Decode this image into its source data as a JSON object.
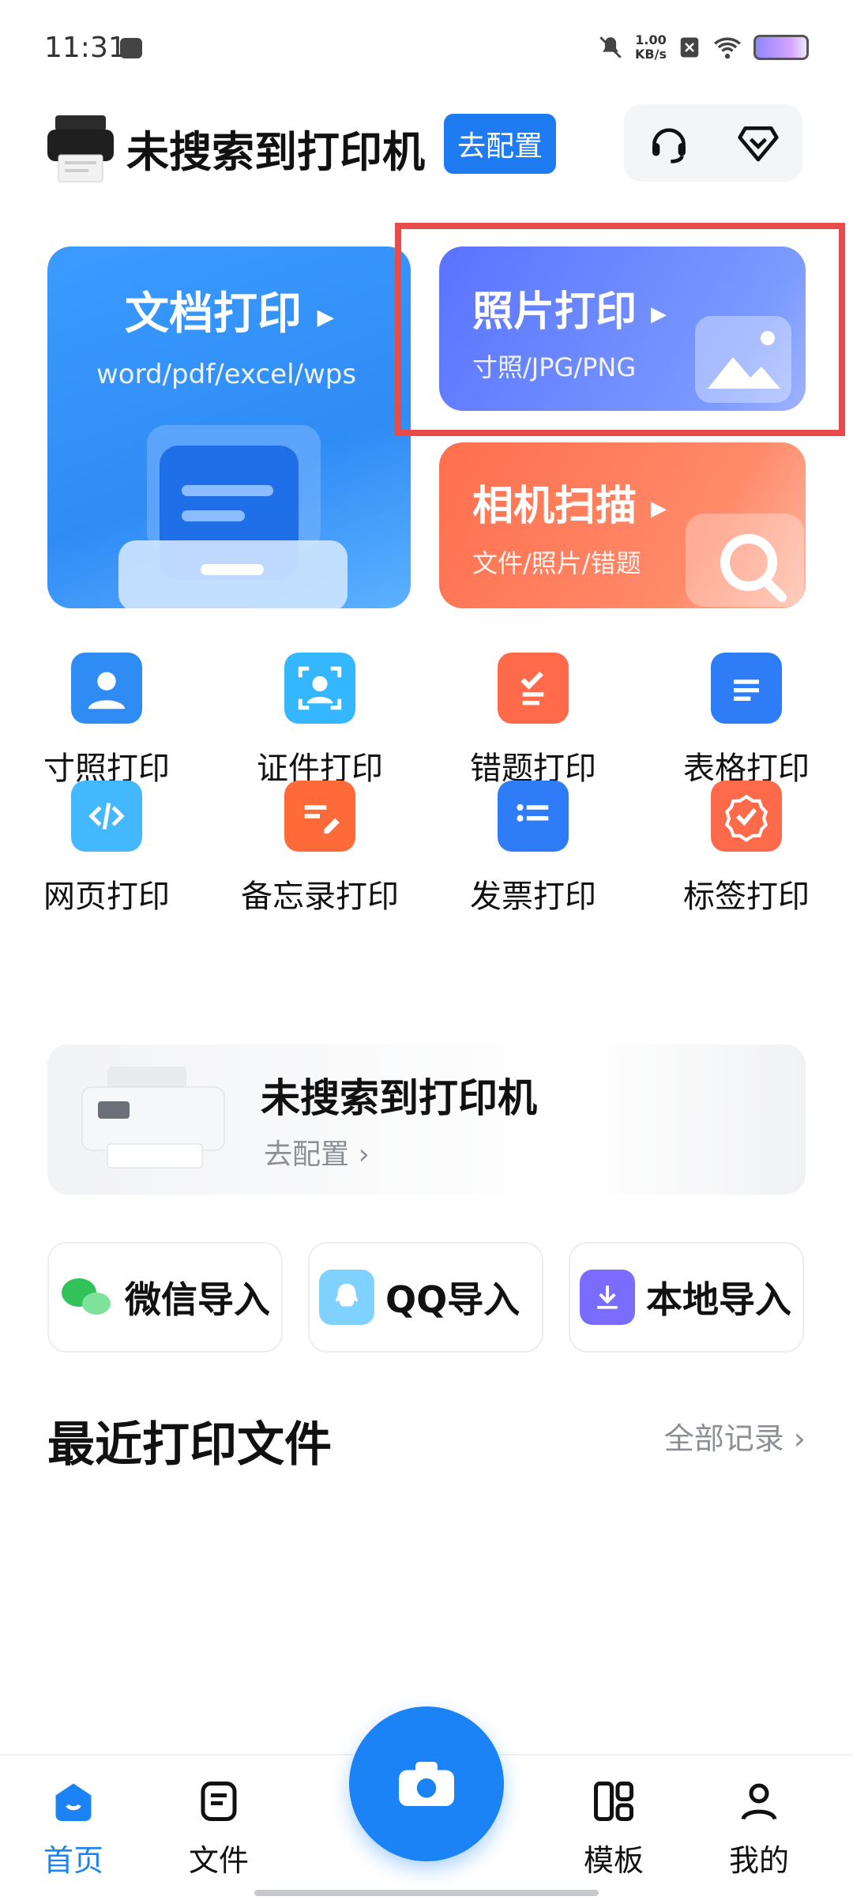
{
  "status": {
    "time": "11:31",
    "speed_value": "1.00",
    "speed_unit": "KB/s"
  },
  "header": {
    "title": "未搜索到打印机",
    "config_label": "去配置"
  },
  "cards": {
    "doc": {
      "title": "文档打印",
      "sub": "word/pdf/excel/wps"
    },
    "photo": {
      "title": "照片打印",
      "sub": "寸照/JPG/PNG"
    },
    "scan": {
      "title": "相机扫描",
      "sub": "文件/照片/错题"
    }
  },
  "grid": [
    {
      "label": "寸照打印",
      "icon": "id-photo-icon",
      "color": "#2f8cf5"
    },
    {
      "label": "证件打印",
      "icon": "id-card-icon",
      "color": "#35b7ff"
    },
    {
      "label": "错题打印",
      "icon": "checklist-icon",
      "color": "#ff6a4a"
    },
    {
      "label": "表格打印",
      "icon": "document-icon",
      "color": "#2f7df6"
    },
    {
      "label": "网页打印",
      "icon": "code-icon",
      "color": "#43b8ff"
    },
    {
      "label": "备忘录打印",
      "icon": "memo-icon",
      "color": "#ff6a39"
    },
    {
      "label": "发票打印",
      "icon": "list-icon",
      "color": "#2f7df6"
    },
    {
      "label": "标签打印",
      "icon": "badge-icon",
      "color": "#ff6a4a"
    }
  ],
  "banner": {
    "title": "未搜索到打印机",
    "sub": "去配置 ›"
  },
  "imports": [
    {
      "label": "微信导入",
      "icon": "wechat-icon",
      "color": "#33c25a"
    },
    {
      "label": "QQ导入",
      "icon": "qq-icon",
      "color": "#46b8ff"
    },
    {
      "label": "本地导入",
      "icon": "download-icon",
      "color": "#7a6cff"
    }
  ],
  "recent": {
    "title": "最近打印文件",
    "all_label": "全部记录 ›"
  },
  "nav": [
    {
      "label": "首页",
      "icon": "home-icon",
      "color": "#1b83f5"
    },
    {
      "label": "文件",
      "icon": "file-icon",
      "color": "#111111"
    },
    {
      "label": "模板",
      "icon": "template-icon",
      "color": "#111111"
    },
    {
      "label": "我的",
      "icon": "profile-icon",
      "color": "#111111"
    }
  ]
}
